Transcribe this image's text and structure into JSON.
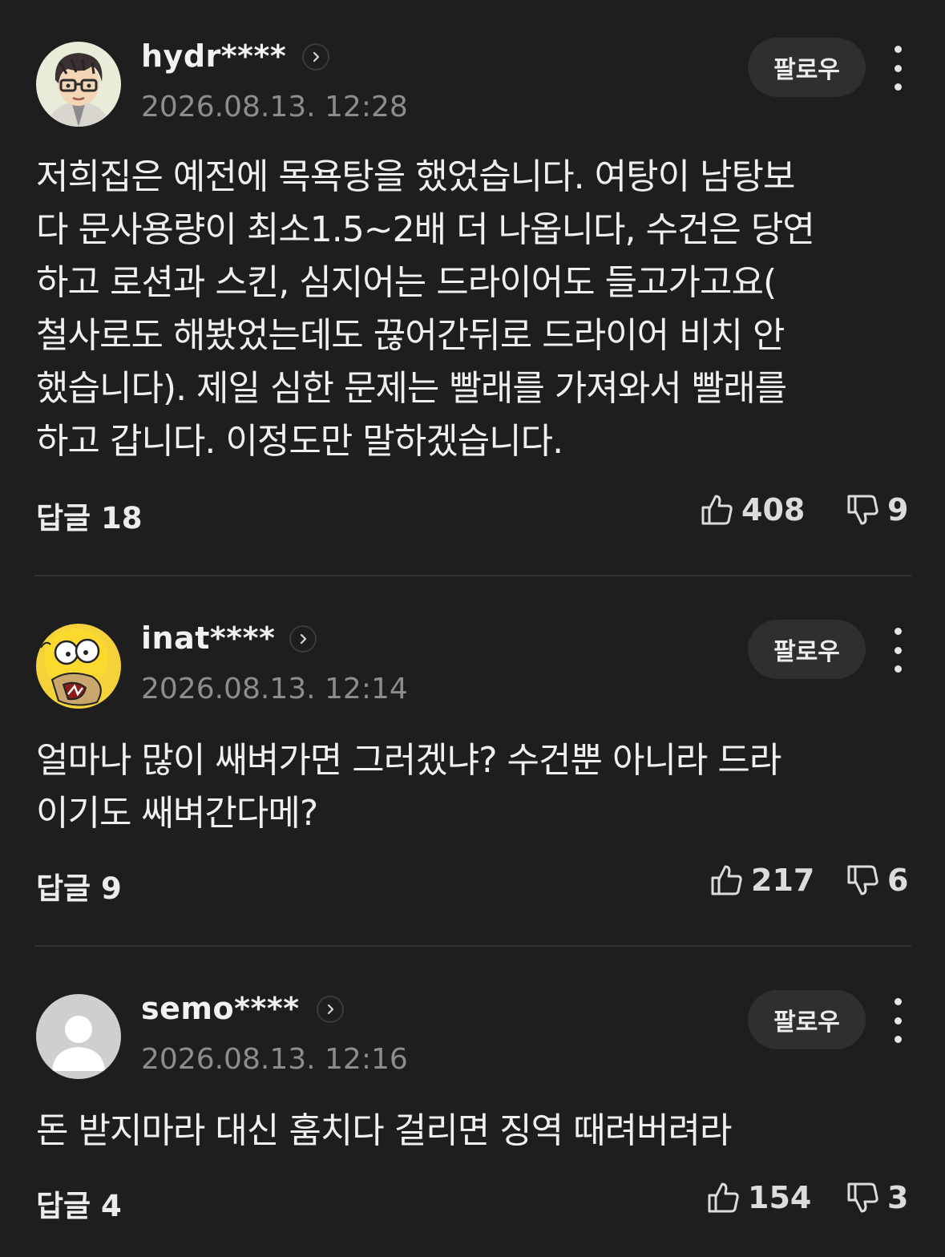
{
  "comments": [
    {
      "username": "hydr****",
      "timestamp": "2026.08.13. 12:28",
      "follow_label": "팔로우",
      "avatar_icon": "glasses-man-avatar-icon",
      "body": "저희집은 예전에 목욕탕을 했었습니다. 여탕이 남탕보\n다 문사용량이 최소1.5~2배 더 나옵니다, 수건은 당연\n하고 로션과 스킨, 심지어는 드라이어도 들고가고요(\n철사로도 해봤었는데도 끊어간뒤로 드라이어 비치 안\n했습니다). 제일 심한 문제는 빨래를 가져와서 빨래를\n하고 갑니다. 이정도만 말하겠습니다.",
      "reply_label": "답글 18",
      "likes": "408",
      "dislikes": "9"
    },
    {
      "username": "inat****",
      "timestamp": "2026.08.13. 12:14",
      "follow_label": "팔로우",
      "avatar_icon": "cartoon-character-avatar-icon",
      "body": "얼마나 많이 쌔벼가면 그러겠냐? 수건뿐 아니라 드라\n이기도 쌔벼간다메?",
      "reply_label": "답글 9",
      "likes": "217",
      "dislikes": "6"
    },
    {
      "username": "semo****",
      "timestamp": "2026.08.13. 12:16",
      "follow_label": "팔로우",
      "avatar_icon": "default-user-avatar-icon",
      "body": "돈 받지마라 대신 훔치다 걸리면 징역 때려버려라",
      "reply_label": "답글 4",
      "likes": "154",
      "dislikes": "3"
    }
  ],
  "icons": {
    "like": "thumbs-up-icon",
    "dislike": "thumbs-down-icon",
    "more": "more-vertical-icon",
    "profile": "chevron-right-icon"
  },
  "colors": {
    "background": "#1e1e1e",
    "text": "#f0f0f0",
    "muted": "#8d8d8d",
    "button": "#2f2f2f",
    "divider": "#333333"
  }
}
